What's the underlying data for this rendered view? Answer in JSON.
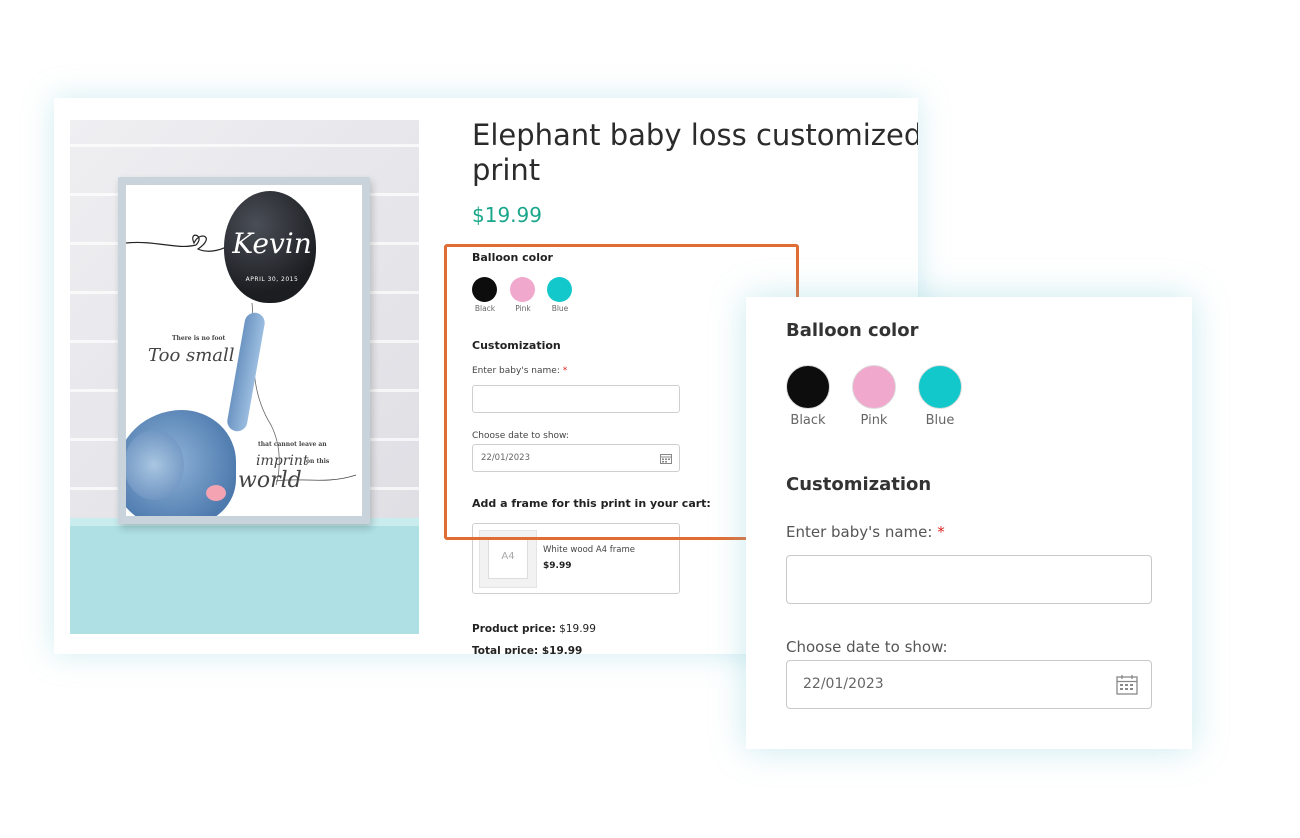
{
  "product": {
    "title_line1": "Elephant baby loss customized",
    "title_line2": "print",
    "price": "$19.99"
  },
  "photo": {
    "balloon_name": "Kevin",
    "balloon_date": "APRIL 30, 2015",
    "poem_line1": "There is no foot",
    "poem_line2": "Too small",
    "poem_line3": "that cannot leave an",
    "poem_line4": "imprint",
    "poem_line4b": "on this",
    "poem_line5": "world"
  },
  "balloon_color": {
    "title": "Balloon color",
    "options": [
      {
        "label": "Black",
        "color": "#0d0d0d"
      },
      {
        "label": "Pink",
        "color": "#f0a8cc"
      },
      {
        "label": "Blue",
        "color": "#12c8cb"
      }
    ]
  },
  "customization": {
    "title": "Customization",
    "name_label": "Enter baby's name:",
    "required_mark": "*",
    "name_value": "",
    "date_label": "Choose date to show:",
    "date_value": "22/01/2023"
  },
  "frame_addon": {
    "title": "Add a frame for this print in your cart:",
    "thumb_text": "A4",
    "name": "White wood A4 frame",
    "price": "$9.99"
  },
  "summary": {
    "product_price_label": "Product price:",
    "product_price_value": "$19.99",
    "partial_line": "Total price: $19.99"
  },
  "colors": {
    "accent_price": "#1aa68a",
    "highlight_border": "#e06d34"
  }
}
